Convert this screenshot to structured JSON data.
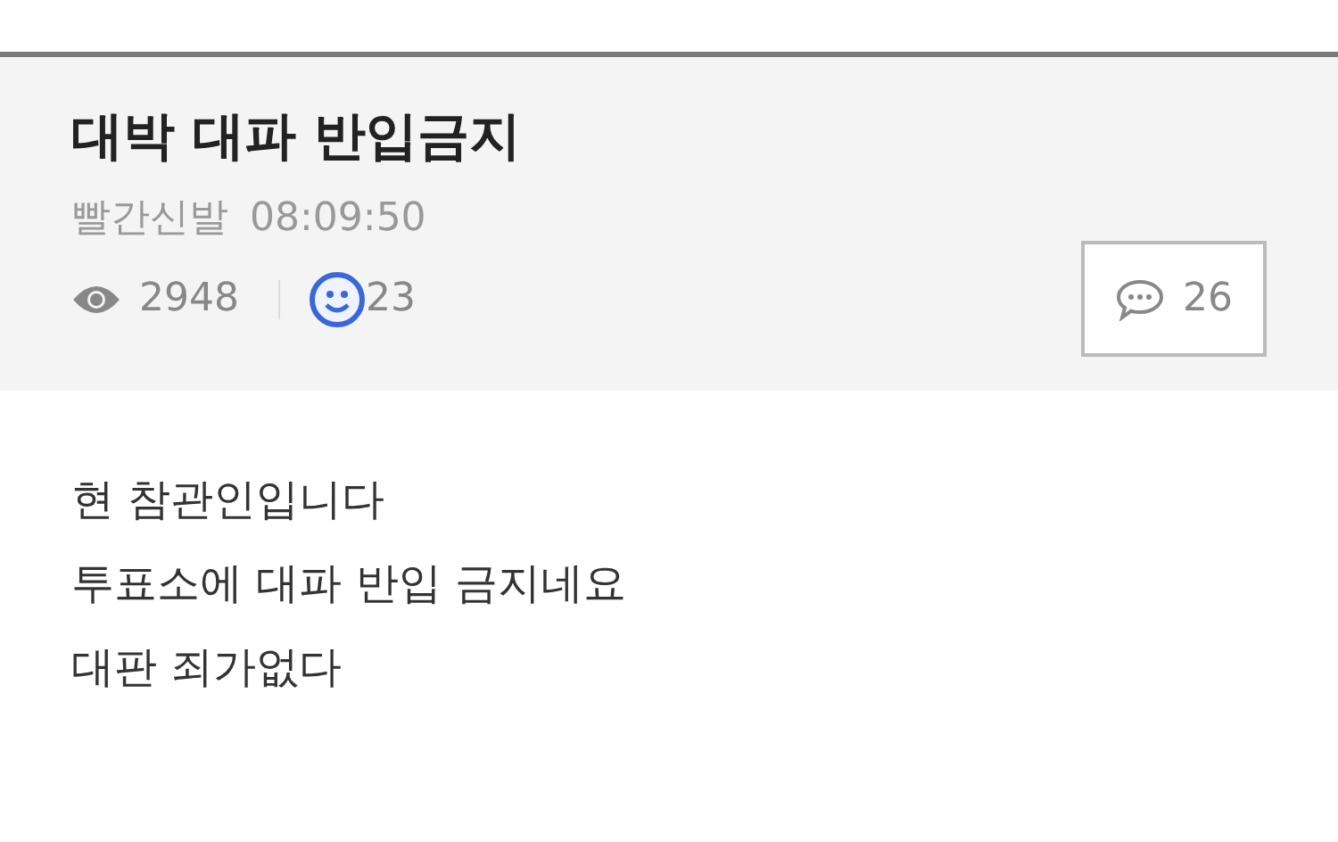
{
  "post": {
    "title": "대박 대파 반입금지",
    "author": "빨간신발",
    "time": "08:09:50",
    "views": "2948",
    "likes": "23",
    "comments": "26"
  },
  "body": [
    "현 참관인입니다",
    "투표소에 대파 반입 금지네요",
    "대판 죄가없다"
  ]
}
